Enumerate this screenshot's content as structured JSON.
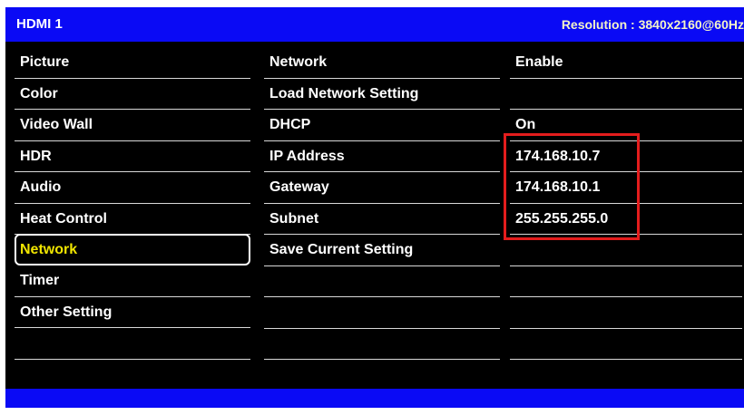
{
  "header": {
    "source": "HDMI 1",
    "resolution": "Resolution : 3840x2160@60Hz"
  },
  "menu": {
    "items": [
      {
        "label": "Picture"
      },
      {
        "label": "Color"
      },
      {
        "label": "Video Wall"
      },
      {
        "label": "HDR"
      },
      {
        "label": "Audio"
      },
      {
        "label": "Heat Control"
      },
      {
        "label": "Network",
        "selected": true
      },
      {
        "label": "Timer"
      },
      {
        "label": "Other Setting"
      },
      {
        "label": ""
      },
      {
        "label": ""
      }
    ]
  },
  "network_settings": {
    "items": [
      {
        "label": "Network",
        "value": "Enable"
      },
      {
        "label": "Load Network Setting",
        "value": ""
      },
      {
        "label": "DHCP",
        "value": "On"
      },
      {
        "label": "IP Address",
        "value": "174.168.10.7"
      },
      {
        "label": "Gateway",
        "value": "174.168.10.1"
      },
      {
        "label": "Subnet",
        "value": "255.255.255.0"
      },
      {
        "label": "Save Current Setting",
        "value": ""
      },
      {
        "label": "",
        "value": ""
      },
      {
        "label": "",
        "value": ""
      },
      {
        "label": "",
        "value": ""
      },
      {
        "label": "",
        "value": ""
      }
    ]
  },
  "colors": {
    "background": "#000000",
    "bar": "#0a0af5",
    "selected_text": "#f0e500",
    "highlight_box": "#e41d1d"
  }
}
